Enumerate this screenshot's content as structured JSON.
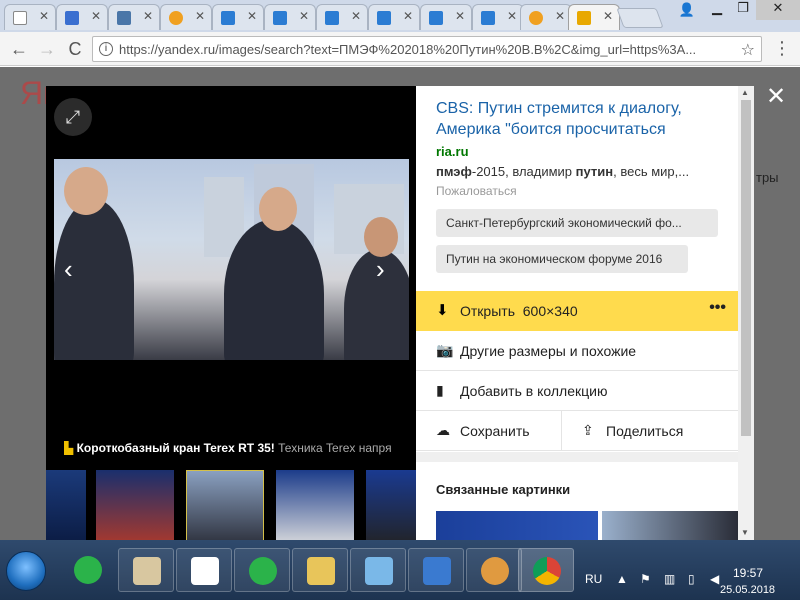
{
  "browser": {
    "tabs": [
      {
        "icon": "page-icon"
      },
      {
        "icon": "slash-icon"
      },
      {
        "icon": "vk-icon"
      },
      {
        "icon": "mail-icon"
      },
      {
        "icon": "window-icon"
      },
      {
        "icon": "window-icon"
      },
      {
        "icon": "window-icon"
      },
      {
        "icon": "window-icon"
      },
      {
        "icon": "window-icon"
      },
      {
        "icon": "window-icon"
      },
      {
        "icon": "mail-icon"
      },
      {
        "icon": "image-icon"
      }
    ],
    "url": "https://yandex.ru/images/search?text=ПМЭФ%202018%20Путин%20В.В%2C&img_url=https%3A...",
    "nav": {
      "back": "←",
      "forward": "→",
      "reload": "C"
    }
  },
  "background": {
    "logo_fragment": "Ян",
    "right_text": "тры"
  },
  "viewer": {
    "caption_bold": "Короткобазный кран Terex RT 35!",
    "caption_gray": "Техника Terex напря"
  },
  "panel": {
    "title": "CBS: Путин стремится к диалогу, Америка \"боится просчитаться",
    "site": "ria.ru",
    "snippet_parts": [
      "пмэф",
      "-2015, владимир ",
      "путин",
      ", весь мир,..."
    ],
    "complain": "Пожаловаться",
    "tags": [
      "Санкт-Петербургский экономический фо...",
      "Путин на экономическом форуме 2016"
    ],
    "open_label": "Открыть",
    "open_size": "600×340",
    "actions": {
      "other_sizes": "Другие размеры и похожие",
      "add_collection": "Добавить в коллекцию",
      "save": "Сохранить",
      "share": "Поделиться"
    },
    "related_title": "Связанные картинки"
  },
  "taskbar": {
    "lang": "RU",
    "time": "19:57",
    "date": "25.05.2018"
  },
  "colors": {
    "accent_yellow": "#ffdb4d",
    "link_blue": "#1a63a8",
    "site_green": "#007700"
  }
}
